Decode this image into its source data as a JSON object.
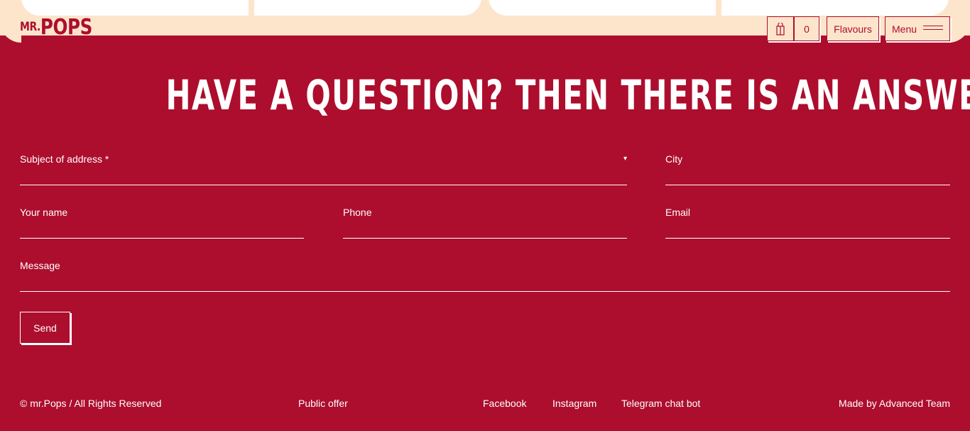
{
  "header": {
    "logo_prefix": "MR.",
    "logo_name": "POPS",
    "cart_icon": "shopping-bag-icon",
    "cart_count": "0",
    "flavours_label": "Flavours",
    "menu_label": "Menu",
    "menu_icon": "hamburger-icon"
  },
  "main": {
    "heading": "HAVE A QUESTION? THEN THERE IS AN ANSWER!"
  },
  "form": {
    "subject_label": "Subject of address *",
    "subject_caret": "▾",
    "city_label": "City",
    "name_label": "Your name",
    "phone_label": "Phone",
    "email_label": "Email",
    "message_label": "Message",
    "send_label": "Send"
  },
  "footer": {
    "copyright": "© mr.Pops / All Rights Reserved",
    "public_offer": "Public offer",
    "facebook": "Facebook",
    "instagram": "Instagram",
    "telegram": "Telegram chat bot",
    "made_by": "Made by Advanced Team"
  },
  "colors": {
    "brand_red": "#ad0e2e",
    "cream": "#fde5cc",
    "white": "#ffffff"
  }
}
